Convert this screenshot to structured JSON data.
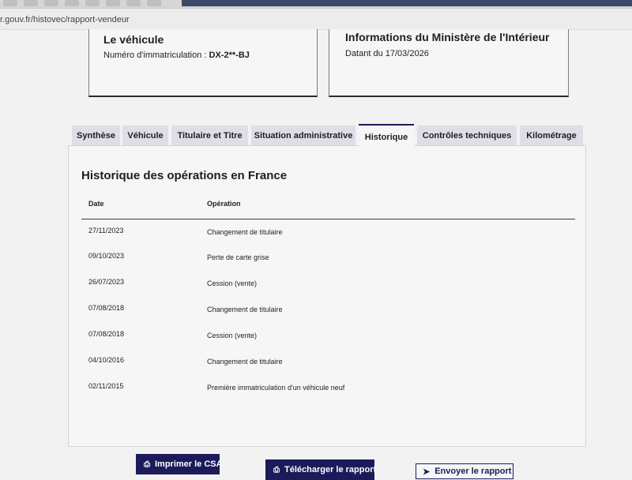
{
  "browser": {
    "url": "r.gouv.fr/histovec/rapport-vendeur"
  },
  "vehicle_card": {
    "title": "Le véhicule",
    "plate_label": "Numéro d'immatriculation : ",
    "plate_value": "DX-2**-BJ"
  },
  "ministry_card": {
    "title": "Informations du Ministère de l'Intérieur",
    "date_text": "Datant du 17/03/2026"
  },
  "tabs": [
    {
      "label": "Synthèse"
    },
    {
      "label": "Véhicule"
    },
    {
      "label": "Titulaire et Titre"
    },
    {
      "label": "Situation administrative"
    },
    {
      "label": "Historique",
      "active": true
    },
    {
      "label": "Contrôles techniques"
    },
    {
      "label": "Kilométrage"
    }
  ],
  "history": {
    "title": "Historique des opérations en France",
    "columns": [
      "Date",
      "Opération"
    ],
    "rows": [
      {
        "date": "27/11/2023",
        "operation": "Changement de titulaire"
      },
      {
        "date": "09/10/2023",
        "operation": "Perte de carte grise"
      },
      {
        "date": "26/07/2023",
        "operation": "Cession (vente)"
      },
      {
        "date": "07/08/2018",
        "operation": "Changement de titulaire"
      },
      {
        "date": "07/08/2018",
        "operation": "Cession (vente)"
      },
      {
        "date": "04/10/2016",
        "operation": "Changement de titulaire"
      },
      {
        "date": "02/11/2015",
        "operation": "Première immatriculation d'un véhicule neuf"
      }
    ]
  },
  "actions": {
    "print_label": "Imprimer le CSA",
    "download_label": "Télécharger le rapport",
    "send_label": "Envoyer le rapport"
  },
  "colors": {
    "primary": "#1b1b5a",
    "tab_bg": "#dedee8",
    "panel_bg": "#f6f6f6"
  }
}
